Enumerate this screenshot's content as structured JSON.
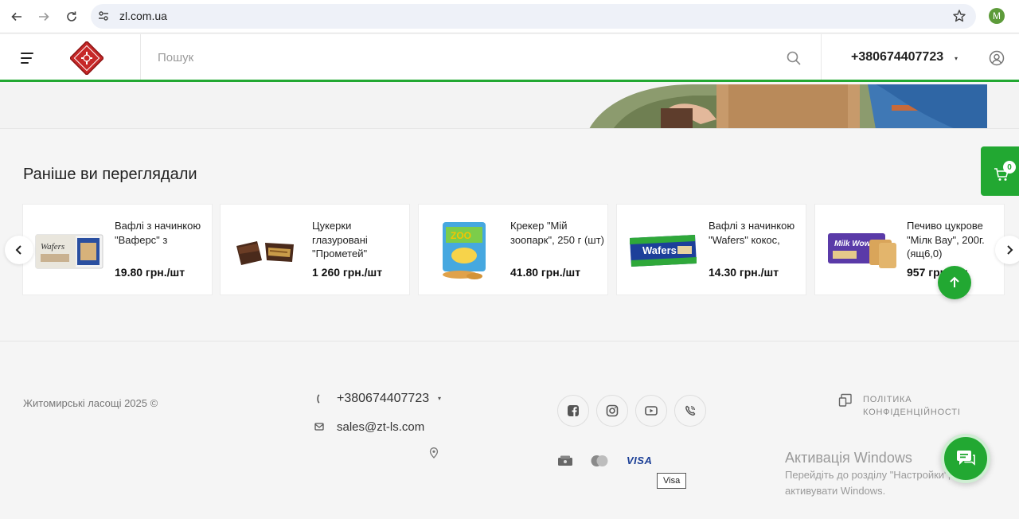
{
  "browser": {
    "url": "zl.com.ua",
    "profile_initial": "M"
  },
  "header": {
    "search_placeholder": "Пошук",
    "phone": "+380674407723",
    "phone_caret": "▾"
  },
  "recently_viewed": {
    "title": "Раніше ви переглядали",
    "items": [
      {
        "name": "Вафлі з начинкою \"Ваферс\" з",
        "price": "19.80 грн./шт"
      },
      {
        "name": "Цукерки глазуровані \"Прометей\"",
        "price": "1 260 грн./шт"
      },
      {
        "name": "Крекер \"Мій зоопарк\", 250 г (шт)",
        "price": "41.80 грн./шт"
      },
      {
        "name": "Вафлі з начинкою \"Wafers\" кокос,",
        "price": "14.30 грн./шт"
      },
      {
        "name": "Печиво цукрове \"Мілк Вау\", 200г. (ящ6,0)",
        "price": "957 грн./шт"
      }
    ]
  },
  "cart": {
    "count": "0"
  },
  "footer": {
    "copyright": "Житомирські ласощі 2025 ©",
    "phone": "+380674407723",
    "phone_caret": "▾",
    "email": "sales@zt-ls.com",
    "visa_label": "VISA",
    "tooltip": "Visa",
    "policy": "ПОЛІТИКА КОНФІДЕНЦІЙНОСТІ"
  },
  "windows_activation": {
    "title": "Активація Windows",
    "text": "Перейдіть до розділу \"Настройки\", щоб активувати Windows."
  },
  "colors": {
    "accent": "#22a832",
    "background": "#f5f5f5",
    "visa": "#1a3e96"
  },
  "icons": [
    "back-icon",
    "forward-icon",
    "reload-icon",
    "site-settings-icon",
    "bookmark-star-icon",
    "menu-icon",
    "search-icon",
    "user-icon",
    "cart-icon",
    "arrow-up-icon",
    "chevron-left-icon",
    "chevron-right-icon",
    "phone-icon",
    "mail-icon",
    "map-pin-icon",
    "facebook-icon",
    "instagram-icon",
    "youtube-icon",
    "viber-icon",
    "document-icon",
    "chat-icon"
  ]
}
